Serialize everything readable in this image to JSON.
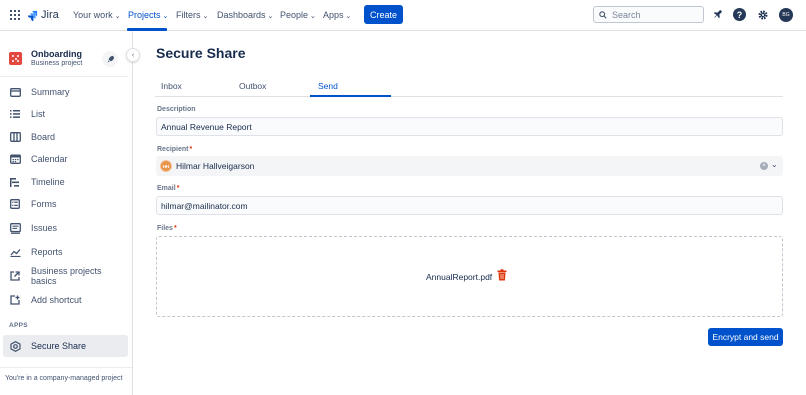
{
  "topnav": {
    "app_name": "Jira",
    "items": [
      {
        "label": "Your work"
      },
      {
        "label": "Projects"
      },
      {
        "label": "Filters"
      },
      {
        "label": "Dashboards"
      },
      {
        "label": "People"
      },
      {
        "label": "Apps"
      }
    ],
    "create_label": "Create",
    "search_placeholder": "Search",
    "avatar_initials": "BG"
  },
  "sidebar": {
    "project_name": "Onboarding",
    "project_type": "Business project",
    "items": [
      {
        "label": "Summary",
        "icon": "summary-icon"
      },
      {
        "label": "List",
        "icon": "list-icon"
      },
      {
        "label": "Board",
        "icon": "board-icon"
      },
      {
        "label": "Calendar",
        "icon": "calendar-icon"
      },
      {
        "label": "Timeline",
        "icon": "timeline-icon"
      },
      {
        "label": "Forms",
        "icon": "forms-icon"
      },
      {
        "label": "Issues",
        "icon": "issues-icon"
      },
      {
        "label": "Reports",
        "icon": "reports-icon"
      },
      {
        "label": "Business projects basics",
        "icon": "external-link-icon"
      },
      {
        "label": "Add shortcut",
        "icon": "add-shortcut-icon"
      }
    ],
    "apps_heading": "APPS",
    "apps_item": {
      "label": "Secure Share",
      "icon": "secure-share-icon"
    },
    "footer": "You're in a company-managed project"
  },
  "main": {
    "title": "Secure Share",
    "tabs": [
      {
        "label": "Inbox"
      },
      {
        "label": "Outbox"
      },
      {
        "label": "Send"
      }
    ],
    "active_tab": "Send",
    "description_label": "Description",
    "description_value": "Annual Revenue Report",
    "recipient_label": "Recipient",
    "recipient_name": "Hilmar Hallveigarson",
    "recipient_initials": "HH",
    "email_label": "Email",
    "email_value": "hilmar@mailinator.com",
    "files_label": "Files",
    "file_name": "AnnualReport.pdf",
    "required_marker": "*",
    "submit_label": "Encrypt and send"
  },
  "colors": {
    "brand": "#0052CC",
    "project_icon": "#E2483D",
    "delete_icon": "#DE350B",
    "recipient_avatar": "#E8944A"
  }
}
